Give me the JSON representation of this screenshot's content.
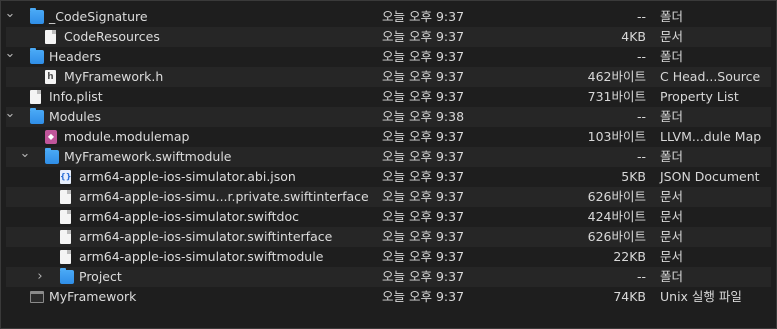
{
  "rows": [
    {
      "name": "_CodeSignature",
      "date": "오늘 오후 9:37",
      "size": "--",
      "kind": "폴더",
      "icon": "folder-icon",
      "chevron": "expanded",
      "depth": 0
    },
    {
      "name": "CodeResources",
      "date": "오늘 오후 9:37",
      "size": "4KB",
      "kind": "문서",
      "icon": "document-icon",
      "chevron": "none",
      "depth": 1
    },
    {
      "name": "Headers",
      "date": "오늘 오후 9:37",
      "size": "--",
      "kind": "폴더",
      "icon": "folder-icon",
      "chevron": "expanded",
      "depth": 0
    },
    {
      "name": "MyFramework.h",
      "date": "오늘 오후 9:37",
      "size": "462바이트",
      "kind": "C Head...Source",
      "icon": "header-file-icon",
      "chevron": "none",
      "depth": 1
    },
    {
      "name": "Info.plist",
      "date": "오늘 오후 9:37",
      "size": "731바이트",
      "kind": "Property List",
      "icon": "document-icon",
      "chevron": "none",
      "depth": 0
    },
    {
      "name": "Modules",
      "date": "오늘 오후 9:38",
      "size": "--",
      "kind": "폴더",
      "icon": "folder-icon",
      "chevron": "expanded",
      "depth": 0
    },
    {
      "name": "module.modulemap",
      "date": "오늘 오후 9:37",
      "size": "103바이트",
      "kind": "LLVM...dule Map",
      "icon": "modulemap-icon",
      "chevron": "none",
      "depth": 1
    },
    {
      "name": "MyFramework.swiftmodule",
      "date": "오늘 오후 9:37",
      "size": "--",
      "kind": "폴더",
      "icon": "folder-icon",
      "chevron": "expanded",
      "depth": 1
    },
    {
      "name": "arm64-apple-ios-simulator.abi.json",
      "date": "오늘 오후 9:37",
      "size": "5KB",
      "kind": "JSON Document",
      "icon": "json-file-icon",
      "chevron": "none",
      "depth": 2
    },
    {
      "name": "arm64-apple-ios-simu...r.private.swiftinterface",
      "date": "오늘 오후 9:37",
      "size": "626바이트",
      "kind": "문서",
      "icon": "document-icon",
      "chevron": "none",
      "depth": 2
    },
    {
      "name": "arm64-apple-ios-simulator.swiftdoc",
      "date": "오늘 오후 9:37",
      "size": "424바이트",
      "kind": "문서",
      "icon": "document-icon",
      "chevron": "none",
      "depth": 2
    },
    {
      "name": "arm64-apple-ios-simulator.swiftinterface",
      "date": "오늘 오후 9:37",
      "size": "626바이트",
      "kind": "문서",
      "icon": "document-icon",
      "chevron": "none",
      "depth": 2
    },
    {
      "name": "arm64-apple-ios-simulator.swiftmodule",
      "date": "오늘 오후 9:37",
      "size": "22KB",
      "kind": "문서",
      "icon": "document-icon",
      "chevron": "none",
      "depth": 2
    },
    {
      "name": "Project",
      "date": "오늘 오후 9:37",
      "size": "--",
      "kind": "폴더",
      "icon": "folder-icon",
      "chevron": "collapsed",
      "depth": 2
    },
    {
      "name": "MyFramework",
      "date": "오늘 오후 9:37",
      "size": "74KB",
      "kind": "Unix 실행 파일",
      "icon": "executable-icon",
      "chevron": "none",
      "depth": 0
    }
  ],
  "colors": {
    "background": "#1e1e1e",
    "stripe": "#262626",
    "folder": "#3b9bf0",
    "text": "#dcdcdc"
  }
}
